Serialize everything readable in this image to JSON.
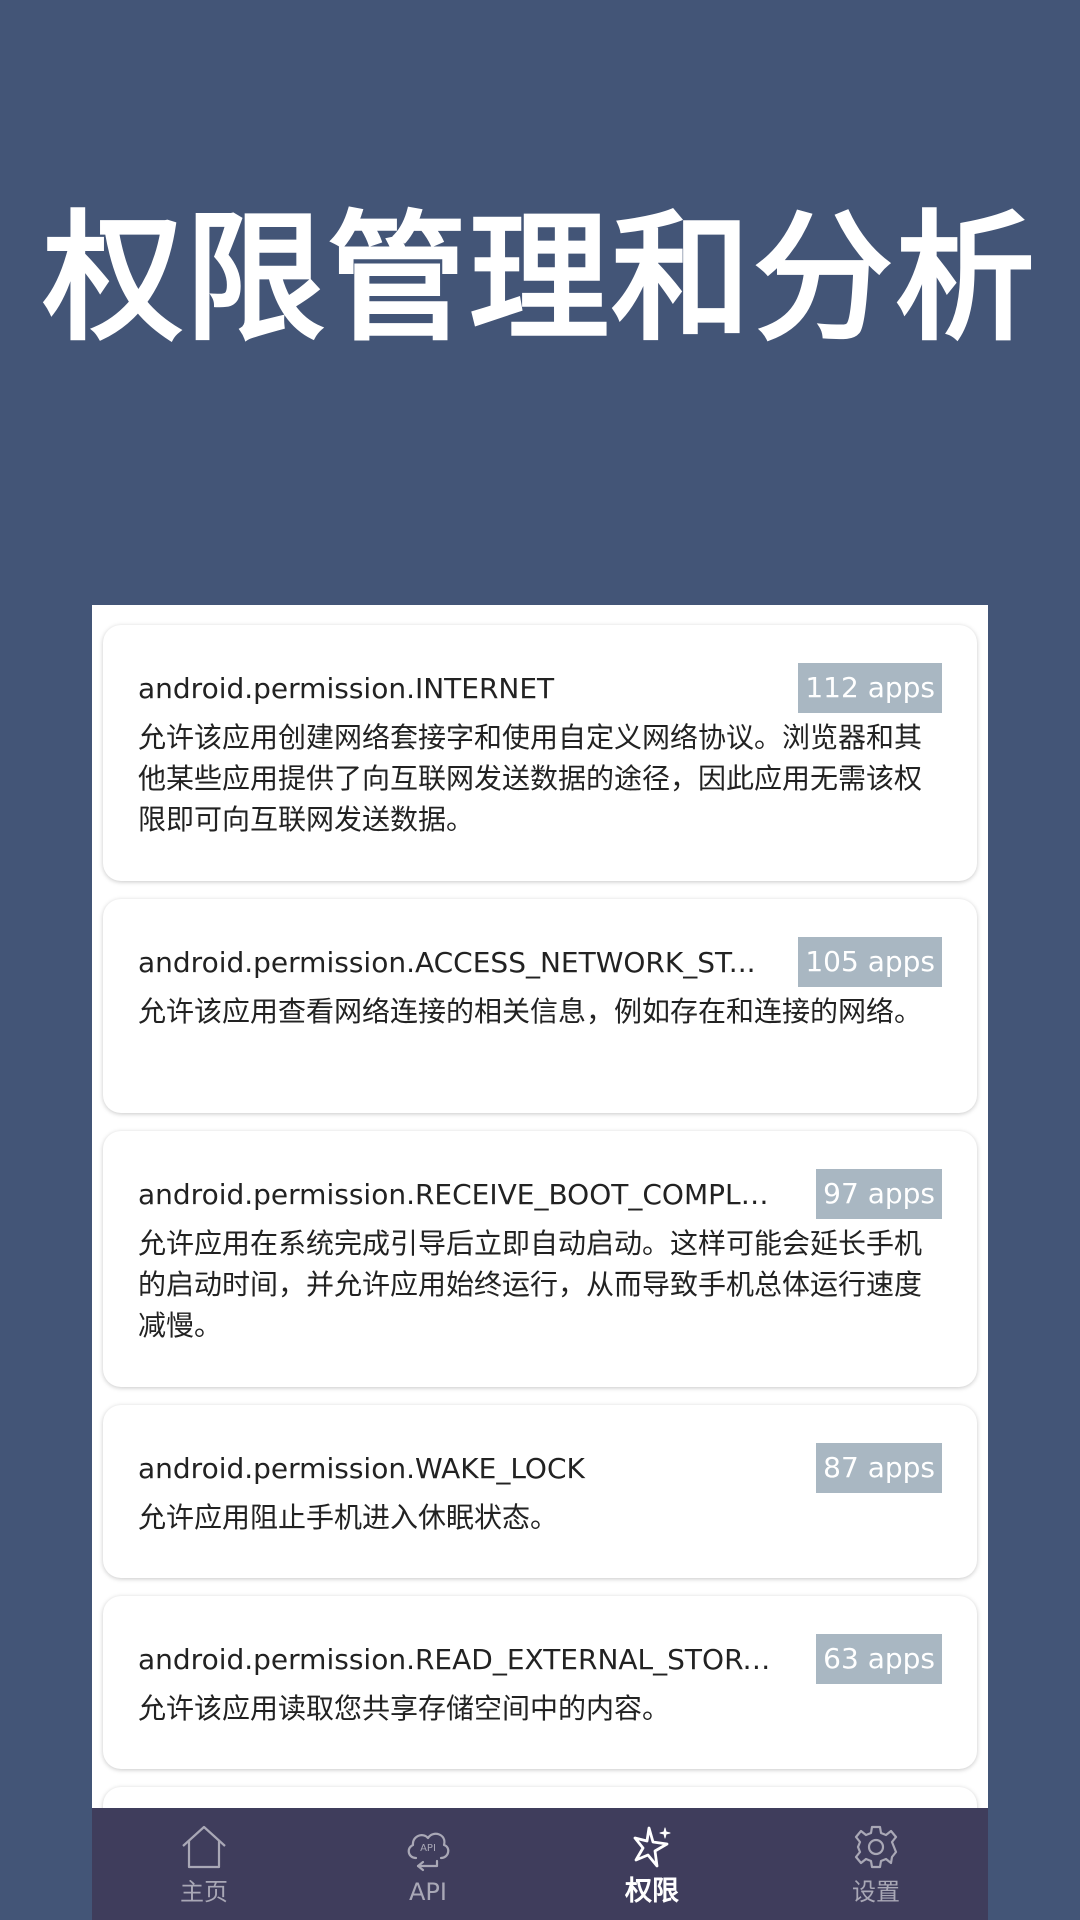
{
  "hero": {
    "title": "权限管理和分析"
  },
  "permissions": [
    {
      "name": "android.permission.INTERNET",
      "count": "112 apps",
      "description": "允许该应用创建网络套接字和使用自定义网络协议。浏览器和其他某些应用提供了向互联网发送数据的途径，因此应用无需该权限即可向互联网发送数据。"
    },
    {
      "name": "android.permission.ACCESS_NETWORK_ST...",
      "count": "105 apps",
      "description": "允许该应用查看网络连接的相关信息，例如存在和连接的网络。"
    },
    {
      "name": "android.permission.RECEIVE_BOOT_COMPLE...",
      "count": "97 apps",
      "description": "允许应用在系统完成引导后立即自动启动。这样可能会延长手机的启动时间，并允许应用始终运行，从而导致手机总体运行速度减慢。"
    },
    {
      "name": "android.permission.WAKE_LOCK",
      "count": "87 apps",
      "description": "允许应用阻止手机进入休眠状态。"
    },
    {
      "name": "android.permission.READ_EXTERNAL_STORA...",
      "count": "63 apps",
      "description": "允许该应用读取您共享存储空间中的内容。"
    }
  ],
  "tabs": [
    {
      "label": "主页",
      "icon": "home-icon",
      "active": false
    },
    {
      "label": "API",
      "icon": "api-cloud-icon",
      "active": false
    },
    {
      "label": "权限",
      "icon": "sparkle-icon",
      "active": true
    },
    {
      "label": "设置",
      "icon": "gear-icon",
      "active": false
    }
  ],
  "colors": {
    "background": "#435577",
    "badge": "#a9b7c2",
    "tabbar": "#3f3d5c"
  }
}
